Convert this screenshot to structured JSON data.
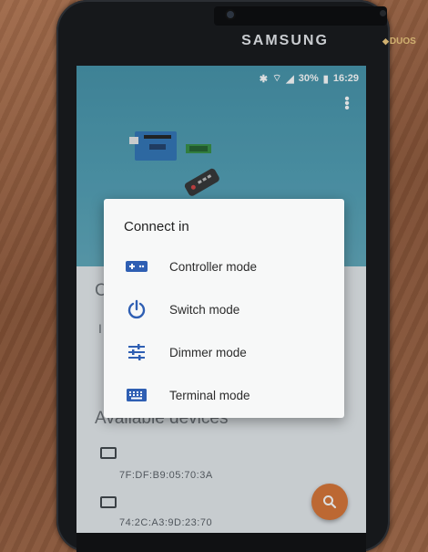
{
  "device": {
    "brand": "SAMSUNG",
    "duos_label": "DUOS"
  },
  "status_bar": {
    "battery": "30%",
    "time": "16:29"
  },
  "background_section": {
    "paired_title_fragment": "C",
    "paired_row_fragment": "I",
    "available_title": "Available devices"
  },
  "devices": [
    {
      "mac": "7F:DF:B9:05:70:3A",
      "icon": "device-icon"
    },
    {
      "mac": "74:2C:A3:9D:23:70",
      "icon": "device-icon"
    }
  ],
  "dialog": {
    "title": "Connect in",
    "options": [
      {
        "label": "Controller mode",
        "icon": "gamepad-icon"
      },
      {
        "label": "Switch mode",
        "icon": "power-icon"
      },
      {
        "label": "Dimmer mode",
        "icon": "sliders-icon"
      },
      {
        "label": "Terminal mode",
        "icon": "keyboard-icon"
      }
    ]
  },
  "colors": {
    "accent": "#2f5fb3",
    "fab": "#d8702e",
    "header": "#4b9bb1"
  }
}
